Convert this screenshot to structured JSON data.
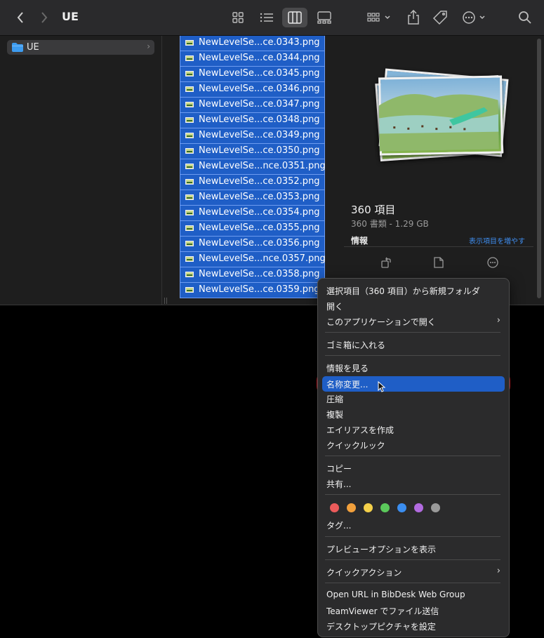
{
  "toolbar": {
    "title": "UE",
    "icons": [
      "back-icon",
      "forward-icon",
      "icon-view-icon",
      "list-view-icon",
      "column-view-icon",
      "gallery-view-icon",
      "group-icon",
      "share-icon",
      "tag-icon",
      "more-icon",
      "search-icon"
    ]
  },
  "sidebar": {
    "items": [
      {
        "label": "UE"
      }
    ]
  },
  "files": [
    "NewLevelSe...ce.0343.png",
    "NewLevelSe...ce.0344.png",
    "NewLevelSe...ce.0345.png",
    "NewLevelSe...ce.0346.png",
    "NewLevelSe...ce.0347.png",
    "NewLevelSe...ce.0348.png",
    "NewLevelSe...ce.0349.png",
    "NewLevelSe...ce.0350.png",
    "NewLevelSe...nce.0351.png",
    "NewLevelSe...ce.0352.png",
    "NewLevelSe...ce.0353.png",
    "NewLevelSe...ce.0354.png",
    "NewLevelSe...ce.0355.png",
    "NewLevelSe...ce.0356.png",
    "NewLevelSe...nce.0357.png",
    "NewLevelSe...ce.0358.png",
    "NewLevelSe...ce.0359.png"
  ],
  "preview": {
    "count": "360 項目",
    "subtitle": "360 書類 - 1.29 GB",
    "info_label": "情報",
    "more_label": "表示項目を増やす"
  },
  "context_menu": {
    "new_folder": "選択項目（360 項目）から新規フォルダ",
    "open": "開く",
    "open_with": "このアプリケーションで開く",
    "trash": "ゴミ箱に入れる",
    "get_info": "情報を見る",
    "rename": "名称変更...",
    "compress": "圧縮",
    "duplicate": "複製",
    "alias": "エイリアスを作成",
    "quicklook": "クイックルック",
    "copy": "コピー",
    "share": "共有...",
    "tags": "タグ...",
    "preview_options": "プレビューオプションを表示",
    "quick_actions": "クイックアクション",
    "bibdesk": "Open URL in BibDesk Web Group",
    "teamviewer": "TeamViewer でファイル送信",
    "desktop_picture": "デスクトップピクチャを設定",
    "tag_colors": [
      "#ec5b5b",
      "#f2a03c",
      "#f4d04a",
      "#5bc95b",
      "#3b8ef0",
      "#b26be0",
      "#9a9a9a"
    ]
  },
  "colors": {
    "selection": "#1f5ec6",
    "highlight_outline": "#e0202a"
  }
}
